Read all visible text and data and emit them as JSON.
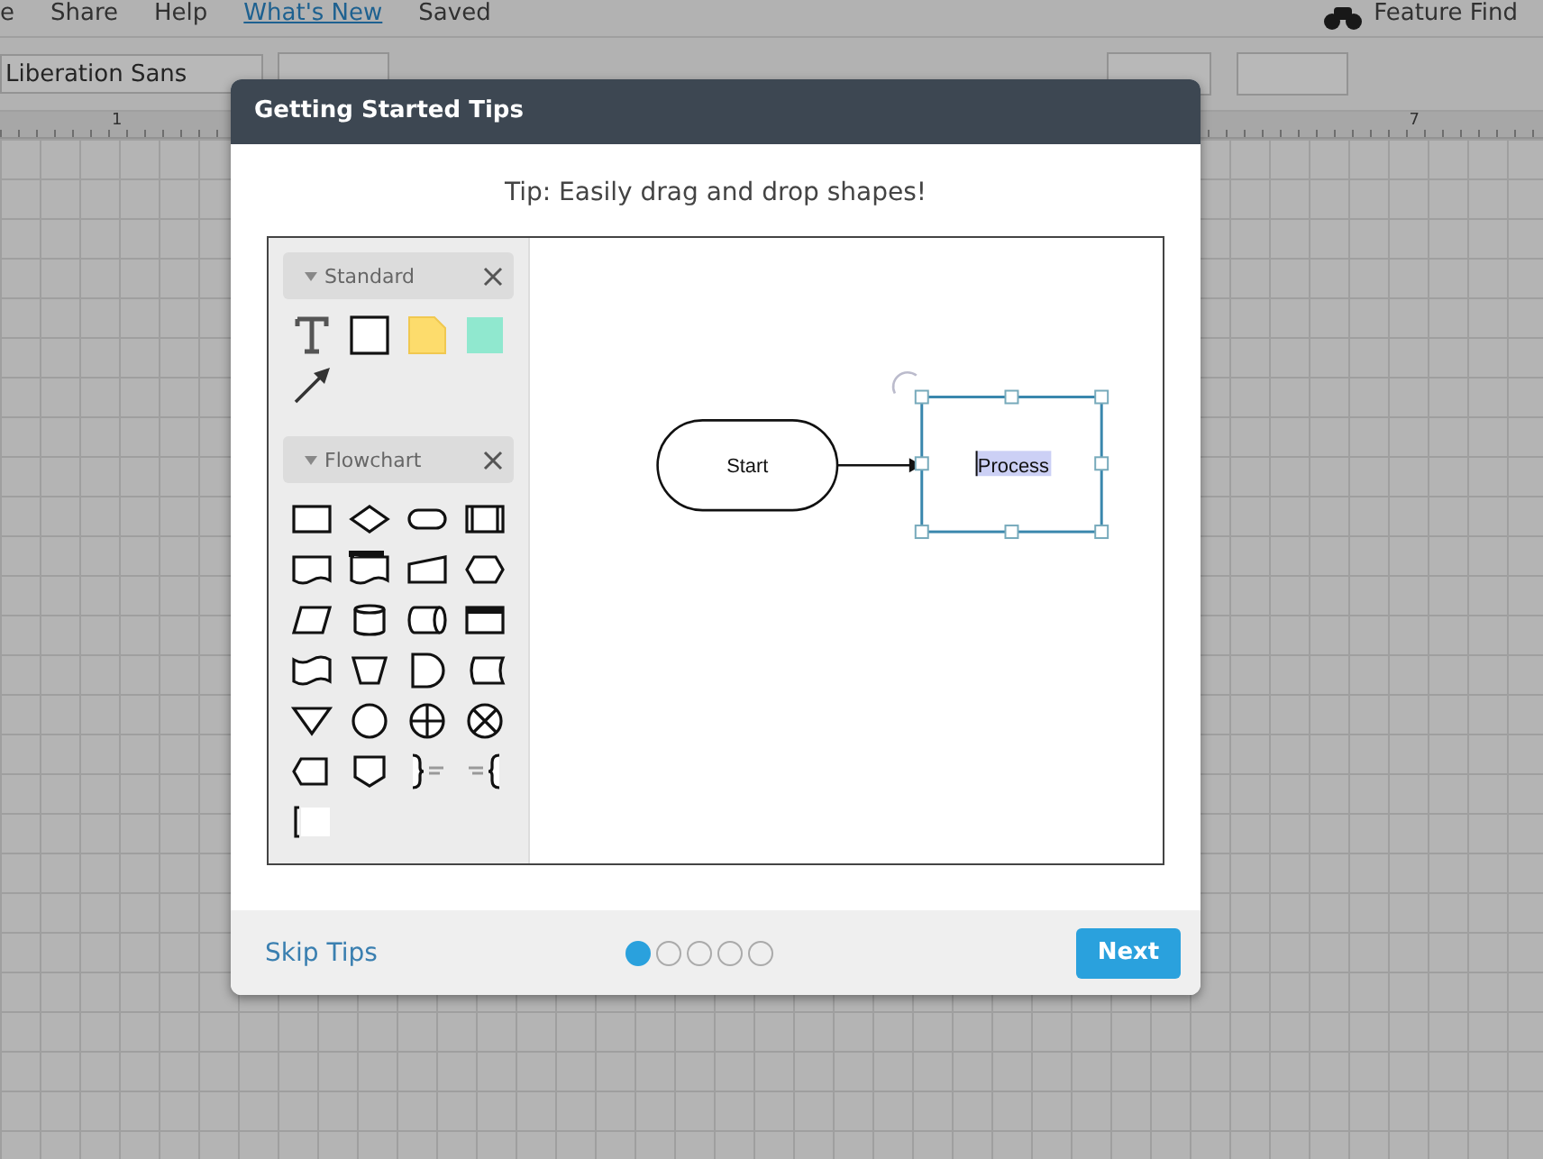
{
  "menu": [
    {
      "label": "e",
      "link": false
    },
    {
      "label": "Share",
      "link": false
    },
    {
      "label": "Help",
      "link": false
    },
    {
      "label": "What's New",
      "link": true
    },
    {
      "label": "Saved",
      "link": false
    }
  ],
  "feature_find": "Feature Find",
  "toolbar": {
    "font": "Liberation Sans"
  },
  "ruler": [
    "1",
    "7"
  ],
  "dialog": {
    "title": "Getting Started Tips",
    "tip": "Tip: Easily drag and drop shapes!",
    "panels": [
      {
        "title": "Standard",
        "expanded": true
      },
      {
        "title": "Flowchart",
        "expanded": true
      }
    ],
    "nodes": [
      {
        "kind": "terminator",
        "label": "Start"
      },
      {
        "kind": "process",
        "label": "Process",
        "selected": true
      }
    ],
    "skip": "Skip Tips",
    "steps": [
      {
        "selected": true
      },
      {
        "selected": false
      },
      {
        "selected": false
      },
      {
        "selected": false
      },
      {
        "selected": false
      }
    ],
    "next": "Next"
  }
}
